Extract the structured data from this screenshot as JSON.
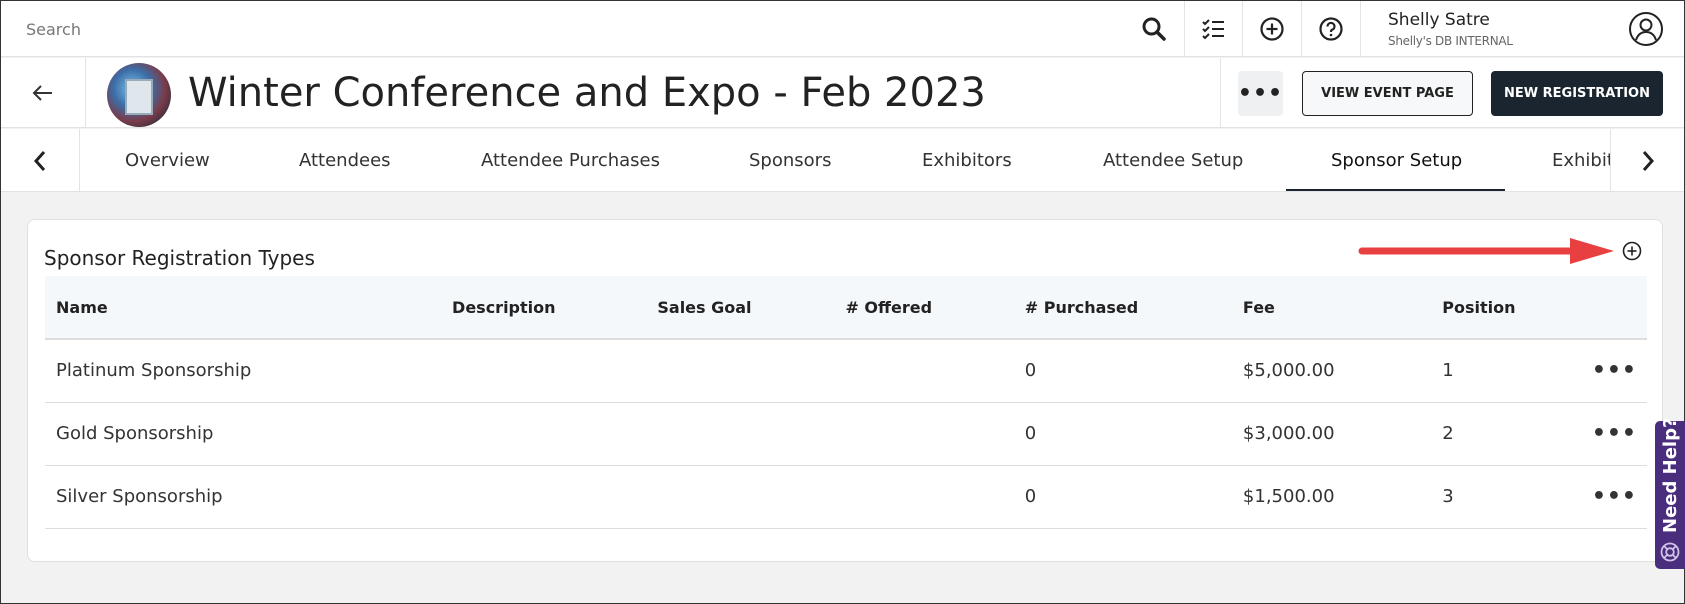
{
  "topbar": {
    "search_placeholder": "Search",
    "icons": [
      "search-icon",
      "checklist-icon",
      "add-circle-icon",
      "help-icon",
      "user-avatar-icon"
    ],
    "user_name": "Shelly Satre",
    "user_org": "Shelly's DB INTERNAL"
  },
  "header": {
    "event_title": "Winter Conference and Expo - Feb 2023",
    "more_label": "•••",
    "view_event_label": "VIEW EVENT PAGE",
    "new_registration_label": "NEW REGISTRATION"
  },
  "tabs": {
    "items": [
      "Overview",
      "Attendees",
      "Attendee Purchases",
      "Sponsors",
      "Exhibitors",
      "Attendee Setup",
      "Sponsor Setup",
      "Exhibit"
    ],
    "active": "Sponsor Setup"
  },
  "card": {
    "title": "Sponsor Registration Types",
    "columns": [
      "Name",
      "Description",
      "Sales Goal",
      "# Offered",
      "# Purchased",
      "Fee",
      "Position"
    ],
    "rows": [
      {
        "name": "Platinum Sponsorship",
        "description": "",
        "sales_goal": "",
        "offered": "",
        "purchased": "0",
        "fee": "$5,000.00",
        "position": "1"
      },
      {
        "name": "Gold Sponsorship",
        "description": "",
        "sales_goal": "",
        "offered": "",
        "purchased": "0",
        "fee": "$3,000.00",
        "position": "2"
      },
      {
        "name": "Silver Sponsorship",
        "description": "",
        "sales_goal": "",
        "offered": "",
        "purchased": "0",
        "fee": "$1,500.00",
        "position": "3"
      }
    ],
    "row_menu_label": "•••"
  },
  "help": {
    "label": "Need Help?"
  },
  "colors": {
    "primary_dark": "#1a2530",
    "annotation_arrow": "#e84040",
    "help_purple": "#4a2d7c"
  }
}
